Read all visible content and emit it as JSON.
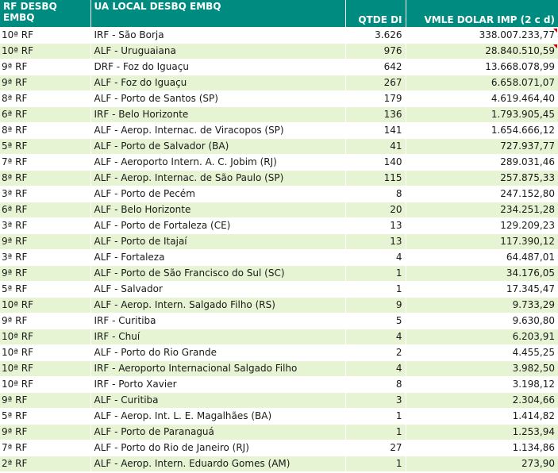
{
  "header": {
    "col_rf_line1": "RF DESBQ",
    "col_rf_line2": "EMBQ",
    "col_ua": "UA LOCAL DESBQ EMBQ",
    "col_qtde": "QTDE DI",
    "col_vmle": "VMLE DOLAR IMP (2 c d)"
  },
  "colors": {
    "header_bg": "#008b80",
    "row_alt_bg": "#e6f4d3",
    "flag": "#cc0000"
  },
  "rows": [
    {
      "rf": "10ª RF",
      "ua": "IRF - São Borja",
      "qtde": "3.626",
      "vmle": "338.007.233,77"
    },
    {
      "rf": "10ª RF",
      "ua": "ALF - Uruguaiana",
      "qtde": "976",
      "vmle": "28.840.510,59"
    },
    {
      "rf": "9ª RF",
      "ua": "DRF - Foz do Iguaçu",
      "qtde": "642",
      "vmle": "13.668.078,99"
    },
    {
      "rf": "9ª RF",
      "ua": "ALF - Foz do Iguaçu",
      "qtde": "267",
      "vmle": "6.658.071,07"
    },
    {
      "rf": "8ª RF",
      "ua": "ALF - Porto de Santos (SP)",
      "qtde": "179",
      "vmle": "4.619.464,40"
    },
    {
      "rf": "6ª RF",
      "ua": "IRF - Belo Horizonte",
      "qtde": "136",
      "vmle": "1.793.905,45"
    },
    {
      "rf": "8ª RF",
      "ua": "ALF - Aerop. Internac. de Viracopos (SP)",
      "qtde": "141",
      "vmle": "1.654.666,12"
    },
    {
      "rf": "5ª RF",
      "ua": "ALF - Porto de Salvador (BA)",
      "qtde": "41",
      "vmle": "727.937,77"
    },
    {
      "rf": "7ª RF",
      "ua": "ALF - Aeroporto Intern. A. C. Jobim (RJ)",
      "qtde": "140",
      "vmle": "289.031,46"
    },
    {
      "rf": "8ª RF",
      "ua": "ALF - Aerop. Internac. de São Paulo (SP)",
      "qtde": "115",
      "vmle": "257.875,33"
    },
    {
      "rf": "3ª RF",
      "ua": "ALF - Porto de Pecém",
      "qtde": "8",
      "vmle": "247.152,80"
    },
    {
      "rf": "6ª RF",
      "ua": "ALF - Belo Horizonte",
      "qtde": "20",
      "vmle": "234.251,28"
    },
    {
      "rf": "3ª RF",
      "ua": "ALF - Porto de Fortaleza (CE)",
      "qtde": "13",
      "vmle": "129.209,23"
    },
    {
      "rf": "9ª RF",
      "ua": "ALF - Porto de Itajaí",
      "qtde": "13",
      "vmle": "117.390,12"
    },
    {
      "rf": "3ª RF",
      "ua": "ALF - Fortaleza",
      "qtde": "4",
      "vmle": "64.487,01"
    },
    {
      "rf": "9ª RF",
      "ua": "ALF - Porto de São Francisco do Sul (SC)",
      "qtde": "1",
      "vmle": "34.176,05"
    },
    {
      "rf": "5ª RF",
      "ua": "ALF - Salvador",
      "qtde": "1",
      "vmle": "17.345,47"
    },
    {
      "rf": "10ª RF",
      "ua": "ALF - Aerop. Intern. Salgado Filho (RS)",
      "qtde": "9",
      "vmle": "9.733,29"
    },
    {
      "rf": "9ª RF",
      "ua": "IRF - Curitiba",
      "qtde": "5",
      "vmle": "9.630,80"
    },
    {
      "rf": "10ª RF",
      "ua": "IRF - Chuí",
      "qtde": "4",
      "vmle": "6.203,91"
    },
    {
      "rf": "10ª RF",
      "ua": "ALF - Porto do Rio Grande",
      "qtde": "2",
      "vmle": "4.455,25"
    },
    {
      "rf": "10ª RF",
      "ua": "IRF - Aeroporto Internacional Salgado Filho",
      "qtde": "4",
      "vmle": "3.982,50"
    },
    {
      "rf": "10ª RF",
      "ua": "IRF - Porto Xavier",
      "qtde": "8",
      "vmle": "3.198,12"
    },
    {
      "rf": "9ª RF",
      "ua": "ALF - Curitiba",
      "qtde": "3",
      "vmle": "2.304,66"
    },
    {
      "rf": "5ª RF",
      "ua": "ALF - Aerop. Int. L. E. Magalhães (BA)",
      "qtde": "1",
      "vmle": "1.414,82"
    },
    {
      "rf": "9ª RF",
      "ua": "ALF - Porto de Paranaguá",
      "qtde": "1",
      "vmle": "1.253,94"
    },
    {
      "rf": "7ª RF",
      "ua": "ALF - Porto do Rio de Janeiro (RJ)",
      "qtde": "27",
      "vmle": "1.134,86"
    },
    {
      "rf": "2ª RF",
      "ua": "ALF - Aerop. Intern. Eduardo Gomes (AM)",
      "qtde": "1",
      "vmle": "273,90"
    }
  ]
}
